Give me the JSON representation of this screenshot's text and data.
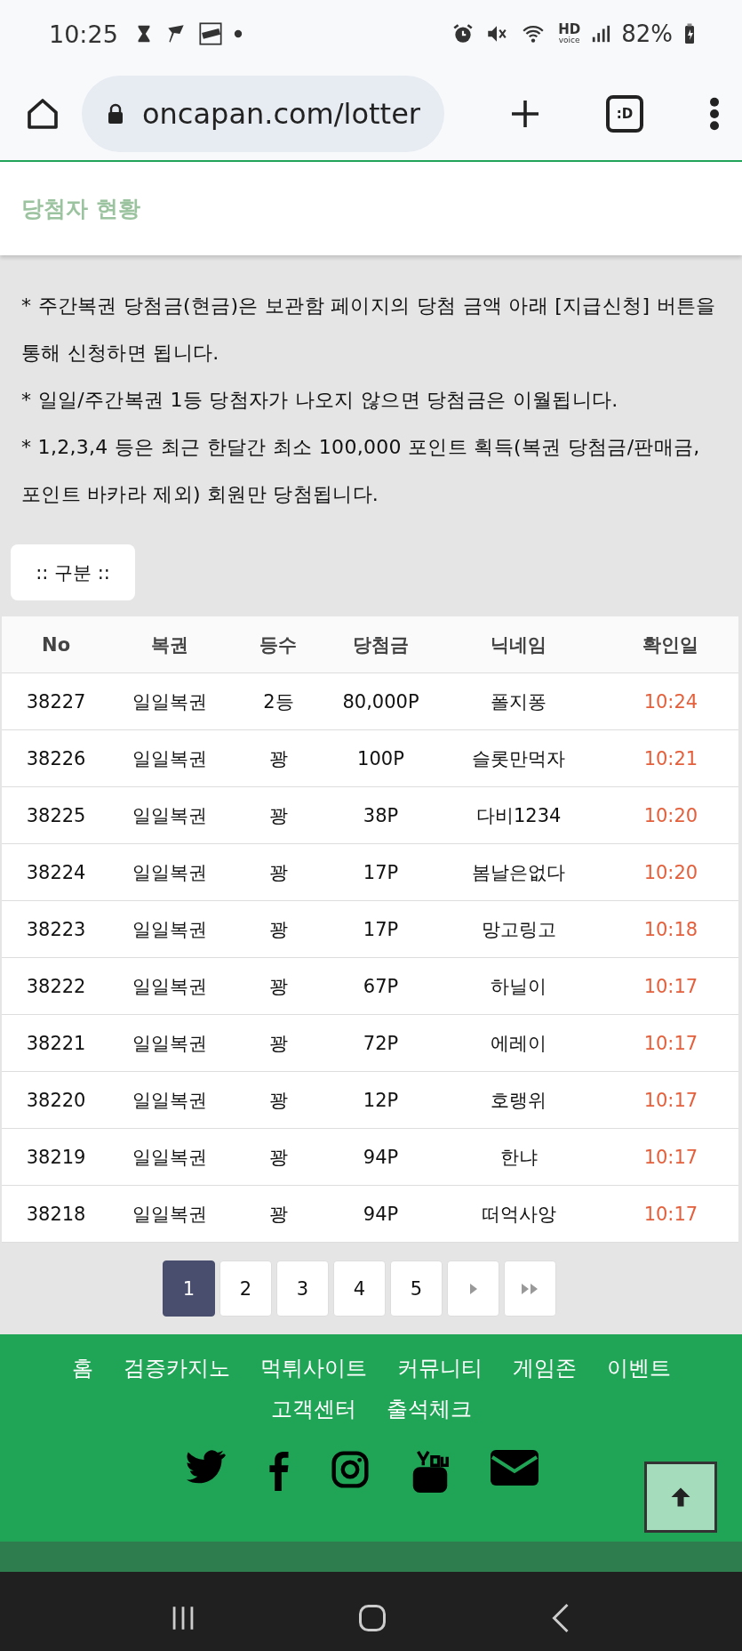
{
  "status_bar": {
    "time": "10:25",
    "network_label": "HD",
    "network_sublabel": "voice",
    "battery": "82%"
  },
  "browser": {
    "url": "oncapan.com/lotter",
    "tab_switcher": ":D"
  },
  "page_header": {
    "title": "당첨자 현황"
  },
  "notes": [
    "* 주간복권 당첨금(현금)은 보관함 페이지의 당첨 금액 아래 [지급신청] 버튼을 통해 신청하면 됩니다.",
    "* 일일/주간복권 1등 당첨자가 나오지 않으면 당첨금은 이월됩니다.",
    "* 1,2,3,4 등은 최근 한달간 최소 100,000 포인트 획득(복권 당첨금/판매금, 포인트 바카라 제외) 회원만 당첨됩니다."
  ],
  "category_button": ":: 구분 ::",
  "table": {
    "columns": [
      "No",
      "복권",
      "등수",
      "당첨금",
      "닉네임",
      "확인일"
    ],
    "rows": [
      [
        "38227",
        "일일복권",
        "2등",
        "80,000P",
        "폴지퐁",
        "10:24"
      ],
      [
        "38226",
        "일일복권",
        "꽝",
        "100P",
        "슬롯만먹자",
        "10:21"
      ],
      [
        "38225",
        "일일복권",
        "꽝",
        "38P",
        "다비1234",
        "10:20"
      ],
      [
        "38224",
        "일일복권",
        "꽝",
        "17P",
        "봄날은없다",
        "10:20"
      ],
      [
        "38223",
        "일일복권",
        "꽝",
        "17P",
        "망고링고",
        "10:18"
      ],
      [
        "38222",
        "일일복권",
        "꽝",
        "67P",
        "하닐이",
        "10:17"
      ],
      [
        "38221",
        "일일복권",
        "꽝",
        "72P",
        "에레이",
        "10:17"
      ],
      [
        "38220",
        "일일복권",
        "꽝",
        "12P",
        "호랭위",
        "10:17"
      ],
      [
        "38219",
        "일일복권",
        "꽝",
        "94P",
        "한냐",
        "10:17"
      ],
      [
        "38218",
        "일일복권",
        "꽝",
        "94P",
        "떠억사앙",
        "10:17"
      ]
    ]
  },
  "pagination": [
    {
      "kind": "page",
      "label": "1",
      "selected": true
    },
    {
      "kind": "page",
      "label": "2",
      "selected": false
    },
    {
      "kind": "page",
      "label": "3",
      "selected": false
    },
    {
      "kind": "page",
      "label": "4",
      "selected": false
    },
    {
      "kind": "page",
      "label": "5",
      "selected": false
    },
    {
      "kind": "next",
      "selected": false
    },
    {
      "kind": "last",
      "selected": false
    }
  ],
  "footer": {
    "links": [
      "홈",
      "검증카지노",
      "먹튀사이트",
      "커뮤니티",
      "게임존",
      "이벤트",
      "고객센터",
      "출석체크"
    ]
  }
}
